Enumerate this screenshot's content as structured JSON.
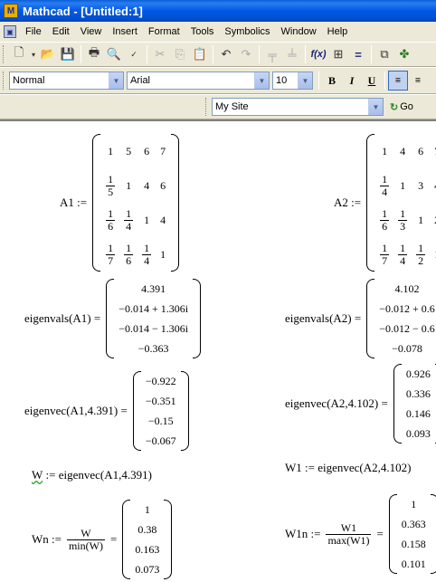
{
  "window": {
    "title": "Mathcad - [Untitled:1]",
    "app_icon_letter": "M"
  },
  "menu": [
    "File",
    "Edit",
    "View",
    "Insert",
    "Format",
    "Tools",
    "Symbolics",
    "Window",
    "Help"
  ],
  "format_bar": {
    "style": "Normal",
    "font": "Arial",
    "size": "10"
  },
  "web_bar": {
    "site": "My Site",
    "go_label": "Go"
  },
  "worksheet": {
    "A1": {
      "label": "A1 :=",
      "rows": [
        [
          "1",
          "5",
          "6",
          "7"
        ],
        [
          "1/5",
          "1",
          "4",
          "6"
        ],
        [
          "1/6",
          "1/4",
          "1",
          "4"
        ],
        [
          "1/7",
          "1/6",
          "1/4",
          "1"
        ]
      ]
    },
    "A2": {
      "label": "A2 :=",
      "rows": [
        [
          "1",
          "4",
          "6",
          "7"
        ],
        [
          "1/4",
          "1",
          "3",
          "4"
        ],
        [
          "1/6",
          "1/3",
          "1",
          "2"
        ],
        [
          "1/7",
          "1/4",
          "1/2",
          "1"
        ]
      ]
    },
    "eigenvals_A1": {
      "label": "eigenvals(A1) =",
      "values": [
        "4.391",
        "−0.014 + 1.306i",
        "−0.014 − 1.306i",
        "−0.363"
      ]
    },
    "eigenvals_A2": {
      "label": "eigenvals(A2) =",
      "values": [
        "4.102",
        "−0.012 + 0.6",
        "−0.012 − 0.6",
        "−0.078"
      ]
    },
    "eigenvec_A1": {
      "label": "eigenvec(A1,4.391) =",
      "values": [
        "−0.922",
        "−0.351",
        "−0.15",
        "−0.067"
      ]
    },
    "eigenvec_A2": {
      "label": "eigenvec(A2,4.102) =",
      "values": [
        "0.926",
        "0.336",
        "0.146",
        "0.093"
      ]
    },
    "W_def": {
      "name": "W",
      "rest": " := eigenvec(A1,4.391)"
    },
    "W1_def": {
      "text": "W1 := eigenvec(A2,4.102)"
    },
    "Wn": {
      "label": "Wn :=",
      "num": "W",
      "den": "min(W)",
      "values": [
        "1",
        "0.38",
        "0.163",
        "0.073"
      ]
    },
    "W1n": {
      "label": "W1n :=",
      "num": "W1",
      "den": "max(W1)",
      "values": [
        "1",
        "0.363",
        "0.158",
        "0.101"
      ]
    }
  }
}
